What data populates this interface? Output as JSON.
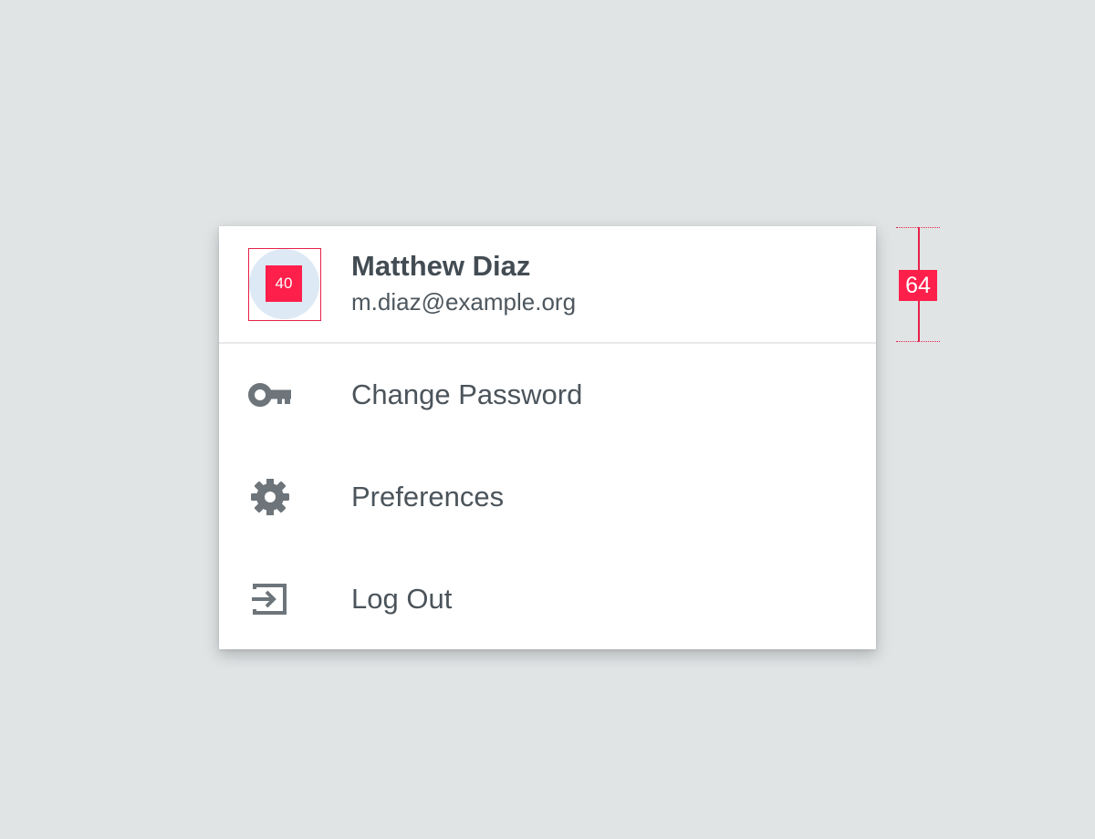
{
  "profile": {
    "name": "Matthew Diaz",
    "email": "m.diaz@example.org"
  },
  "menu": {
    "items": [
      {
        "label": "Change Password",
        "icon": "key-icon"
      },
      {
        "label": "Preferences",
        "icon": "gear-icon"
      },
      {
        "label": "Log Out",
        "icon": "log-out-icon"
      }
    ]
  },
  "annotations": {
    "avatar_size_label": "40",
    "header_height_label": "64"
  },
  "colors": {
    "background": "#e0e4e5",
    "card": "#ffffff",
    "text": "#434c53",
    "icon": "#6d757b",
    "avatar": "#dde9f5",
    "redline": "#ff1f4b"
  }
}
